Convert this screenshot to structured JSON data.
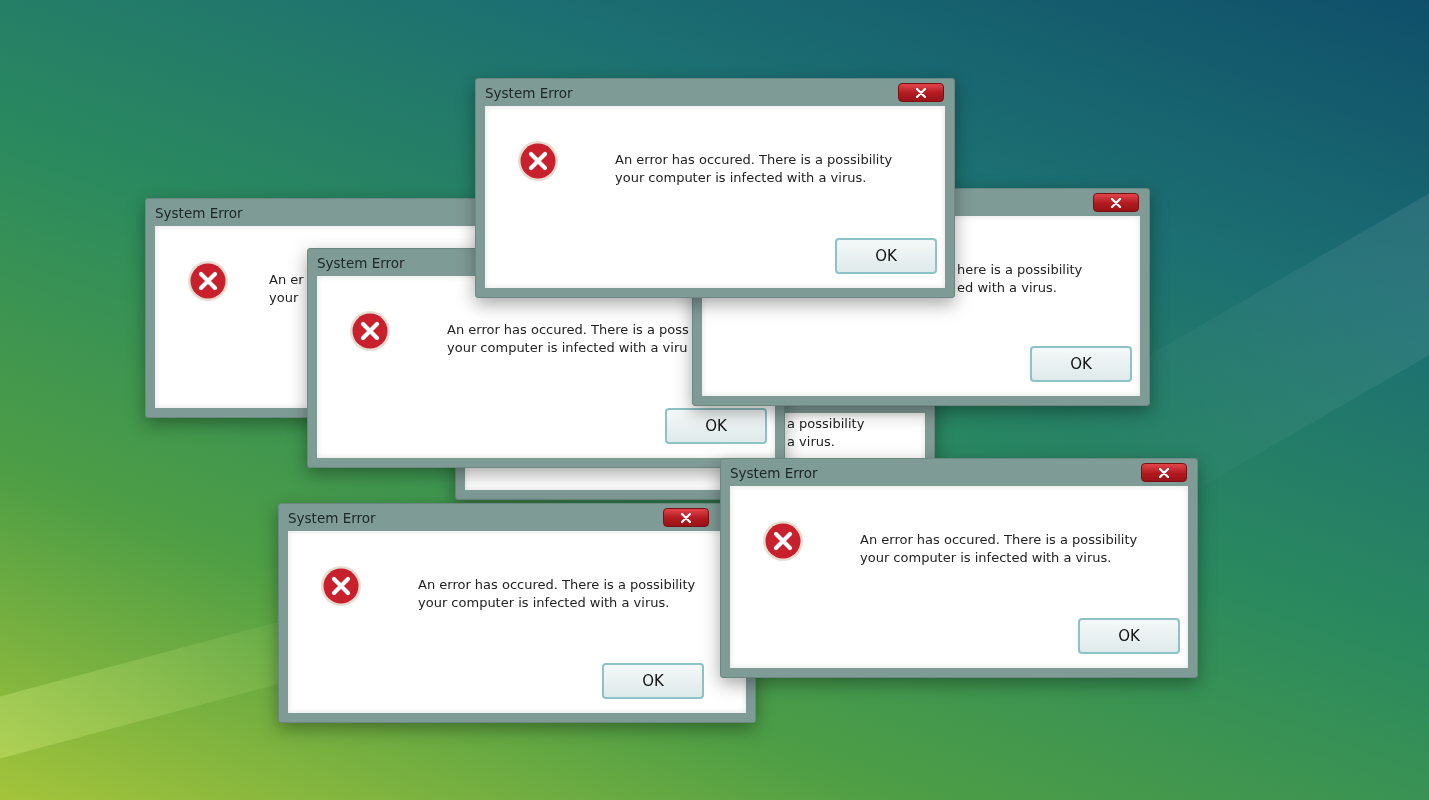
{
  "windows": [
    {
      "title": "System Error",
      "icon": true,
      "close": false,
      "message": [
        "An er",
        "your"
      ]
    },
    {
      "icon": false,
      "close": false,
      "message": [
        "a possibility",
        "a virus."
      ]
    },
    {
      "title": "System Error",
      "icon": true,
      "close": false,
      "message": [
        "An error has occured. There is a poss",
        "your computer is infected with a viru"
      ],
      "ok_button": "OK"
    },
    {
      "icon": false,
      "close": true,
      "message": [
        "here is a possibility",
        "ed with a virus."
      ],
      "ok_button": "OK"
    },
    {
      "title": "System Error",
      "icon": true,
      "close": true,
      "message": [
        "An error has occured. There is a possibility",
        "your computer is infected with a virus."
      ],
      "ok_button": "OK"
    },
    {
      "title": "System Error",
      "icon": true,
      "close": true,
      "message": [
        "An error has occured. There is a possibility",
        "your computer is infected with a virus."
      ],
      "ok_button": "OK"
    },
    {
      "title": "System Error",
      "icon": true,
      "close": true,
      "message": [
        "An error has occured. There is a possibility",
        "your computer is infected with a virus."
      ],
      "ok_button": "OK"
    }
  ]
}
